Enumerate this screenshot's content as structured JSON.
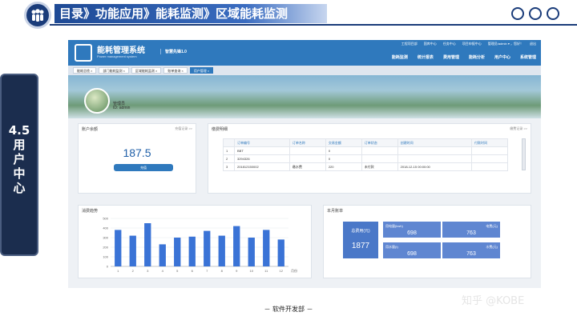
{
  "slide": {
    "breadcrumb": "目录》功能应用》能耗监测》区域能耗监测",
    "side_tab": [
      "4.5",
      "用",
      "户",
      "中",
      "心"
    ],
    "footer": "－ 软件开发部 －",
    "watermark": "知乎 @KOBE"
  },
  "app": {
    "name": "能耗管理系统",
    "subtitle": "Power management system",
    "version": "智慧先锋1.0",
    "util_links": [
      "工程项目部",
      "国库中心",
      "任务中心",
      "项目申报中心",
      "管理员/admin ▾ ，您好！",
      "退出"
    ],
    "main_nav": [
      "能耗监测",
      "统计报表",
      "费用管理",
      "能耗分析",
      "用户中心",
      "系统管理"
    ],
    "tabs": [
      {
        "label": "能耗总揽 ×",
        "active": false
      },
      {
        "label": "部门能耗监测 ×",
        "active": false
      },
      {
        "label": "区域能耗监测 ×",
        "active": false
      },
      {
        "label": "账单查询 ×",
        "active": false
      },
      {
        "label": "用户管理 ×",
        "active": true
      }
    ],
    "user": {
      "name": "管理员",
      "id": "ID: admin"
    },
    "balance_panel": {
      "title": "账户余额",
      "more": "充值记录 >>",
      "amount": "187.5",
      "button": "充值"
    },
    "payment_panel": {
      "title": "缴费明细",
      "more": "缴费记录 >>",
      "columns": [
        "订单编号",
        "订单名称",
        "交易金额",
        "订单状态",
        "创建时间",
        "付款时间"
      ],
      "rows": [
        [
          "1",
          "BBT",
          "",
          "0",
          "",
          "",
          ""
        ],
        [
          "2",
          "3294326",
          "",
          "0",
          "",
          "",
          ""
        ],
        [
          "3",
          "201812150002",
          "缴水费",
          "220",
          "未付款",
          "2018-12-15 00:00:00",
          ""
        ]
      ]
    },
    "consumption_panel": {
      "title": "消费趋势"
    },
    "bill_panel": {
      "title": "本月账单",
      "total_label": "总费用(元)",
      "total_value": "1877",
      "items": [
        {
          "label": "用电量(kwh)",
          "value": "698"
        },
        {
          "label": "电费(元)",
          "value": "763"
        },
        {
          "label": "用水量(t)",
          "value": "698"
        },
        {
          "label": "水费(元)",
          "value": "763"
        }
      ]
    }
  },
  "chart_data": {
    "type": "bar",
    "categories": [
      "1",
      "2",
      "3",
      "4",
      "5",
      "6",
      "7",
      "8",
      "9",
      "10",
      "11",
      "12"
    ],
    "values": [
      380,
      320,
      450,
      230,
      300,
      310,
      370,
      320,
      420,
      300,
      380,
      280
    ],
    "ylim": [
      0,
      500
    ],
    "yticks": [
      "0",
      "100",
      "200",
      "300",
      "400",
      "500"
    ],
    "xlabel": "月份",
    "color": "#3a73d6"
  }
}
